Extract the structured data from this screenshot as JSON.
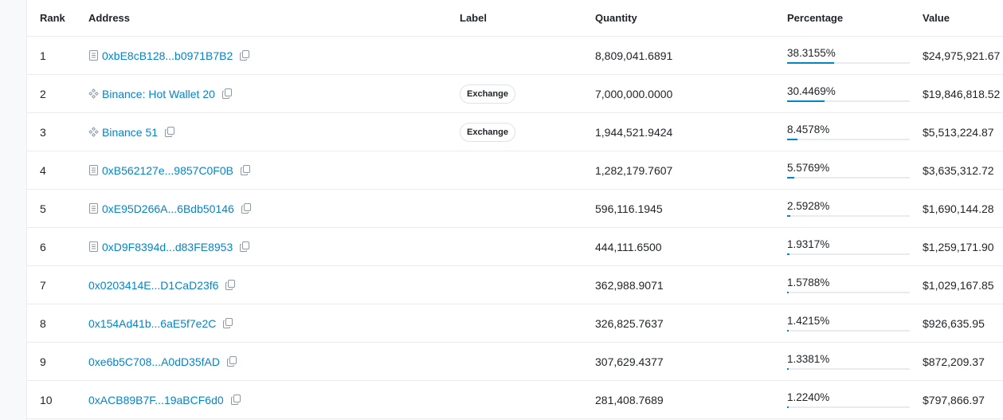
{
  "table": {
    "headers": {
      "rank": "Rank",
      "address": "Address",
      "label": "Label",
      "quantity": "Quantity",
      "percentage": "Percentage",
      "value": "Value"
    },
    "rows": [
      {
        "rank": "1",
        "address": "0xbE8cB128...b0971B7B2",
        "icon": "contract-icon",
        "label": "",
        "quantity": "8,809,041.6891",
        "percentage": "38.3155%",
        "pct": 0.383155,
        "value": "$24,975,921.67"
      },
      {
        "rank": "2",
        "address": "Binance: Hot Wallet 20",
        "icon": "exchange-diamond-icon",
        "label": "Exchange",
        "quantity": "7,000,000.0000",
        "percentage": "30.4469%",
        "pct": 0.304469,
        "value": "$19,846,818.52"
      },
      {
        "rank": "3",
        "address": "Binance 51",
        "icon": "exchange-diamond-icon",
        "label": "Exchange",
        "quantity": "1,944,521.9424",
        "percentage": "8.4578%",
        "pct": 0.084578,
        "value": "$5,513,224.87"
      },
      {
        "rank": "4",
        "address": "0xB562127e...9857C0F0B",
        "icon": "contract-icon",
        "label": "",
        "quantity": "1,282,179.7607",
        "percentage": "5.5769%",
        "pct": 0.055769,
        "value": "$3,635,312.72"
      },
      {
        "rank": "5",
        "address": "0xE95D266A...6Bdb50146",
        "icon": "contract-icon",
        "label": "",
        "quantity": "596,116.1945",
        "percentage": "2.5928%",
        "pct": 0.025928,
        "value": "$1,690,144.28"
      },
      {
        "rank": "6",
        "address": "0xD9F8394d...d83FE8953",
        "icon": "contract-icon",
        "label": "",
        "quantity": "444,111.6500",
        "percentage": "1.9317%",
        "pct": 0.019317,
        "value": "$1,259,171.90"
      },
      {
        "rank": "7",
        "address": "0x0203414E...D1CaD23f6",
        "icon": "",
        "label": "",
        "quantity": "362,988.9071",
        "percentage": "1.5788%",
        "pct": 0.015788,
        "value": "$1,029,167.85"
      },
      {
        "rank": "8",
        "address": "0x154Ad41b...6aE5f7e2C",
        "icon": "",
        "label": "",
        "quantity": "326,825.7637",
        "percentage": "1.4215%",
        "pct": 0.014215,
        "value": "$926,635.95"
      },
      {
        "rank": "9",
        "address": "0xe6b5C708...A0dD35fAD",
        "icon": "",
        "label": "",
        "quantity": "307,629.4377",
        "percentage": "1.3381%",
        "pct": 0.013381,
        "value": "$872,209.37"
      },
      {
        "rank": "10",
        "address": "0xACB89B7F...19aBCF6d0",
        "icon": "",
        "label": "",
        "quantity": "281,408.7689",
        "percentage": "1.2240%",
        "pct": 0.01224,
        "value": "$797,866.97"
      }
    ]
  },
  "colors": {
    "link": "#0784c3",
    "bar_fill": "#0784c3",
    "bar_track": "#e9ecef",
    "border": "#e9ecef"
  }
}
